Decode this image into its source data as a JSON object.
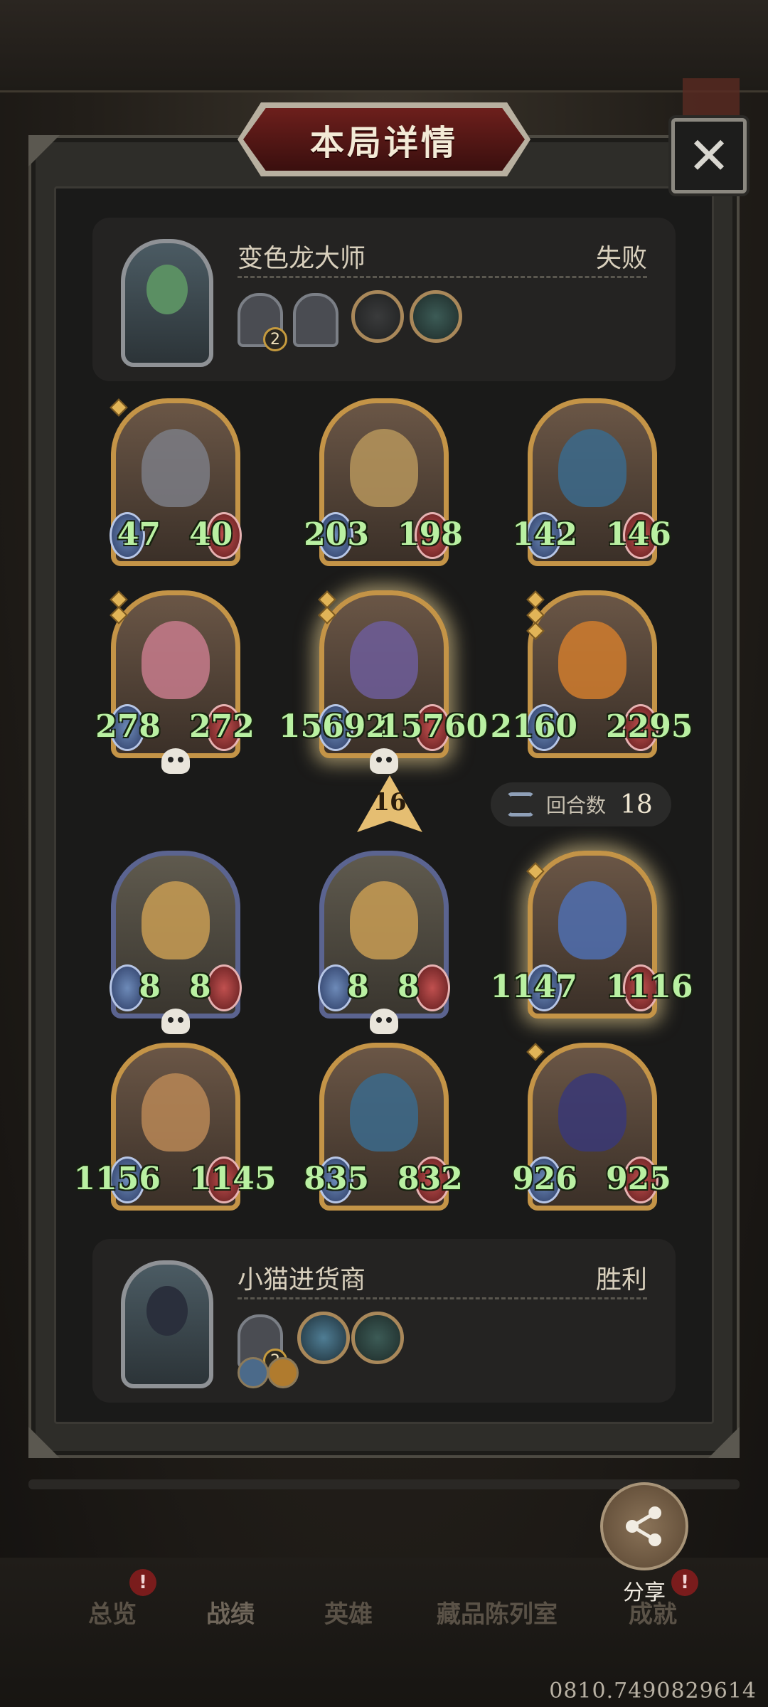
{
  "window": {
    "title": "本局详情",
    "close_glyph": "✕"
  },
  "opponent": {
    "name": "变色龙大师",
    "result": "失败",
    "portrait": "chameleon-master-portrait",
    "slots": [
      {
        "level": "2"
      }
    ],
    "relic_count": 3
  },
  "player": {
    "name": "小猫进货商",
    "result": "胜利",
    "portrait": "cat-merchant-portrait",
    "slots": [
      {
        "level": "2"
      }
    ]
  },
  "opponent_board": [
    {
      "name": "knight-minion",
      "attack": "47",
      "health": "40",
      "dead": false,
      "stars": 1
    },
    {
      "name": "scarecrow-minion",
      "attack": "203",
      "health": "198",
      "dead": false,
      "stars": 0
    },
    {
      "name": "elf-sorceress-minion",
      "attack": "142",
      "health": "146",
      "dead": false,
      "stars": 0
    },
    {
      "name": "dryad-minion",
      "attack": "278",
      "health": "272",
      "dead": true,
      "stars": 2
    },
    {
      "name": "dragon-minion",
      "attack": "15692",
      "health": "15760",
      "dead": true,
      "stars": 2
    },
    {
      "name": "pumpkin-minion",
      "attack": "2160",
      "health": "2295",
      "dead": false,
      "stars": 3
    }
  ],
  "player_board": [
    {
      "name": "pinocchio-minion",
      "attack": "8",
      "health": "8",
      "dead": true
    },
    {
      "name": "pinocchio-minion",
      "attack": "8",
      "health": "8",
      "dead": true
    },
    {
      "name": "star-mage-minion",
      "attack": "1147",
      "health": "1116",
      "dead": false
    },
    {
      "name": "dwarf-king-minion",
      "attack": "1156",
      "health": "1145",
      "dead": false
    },
    {
      "name": "elf-sorceress-minion",
      "attack": "835",
      "health": "832",
      "dead": false
    },
    {
      "name": "witch-hat-minion",
      "attack": "926",
      "health": "925",
      "dead": false
    }
  ],
  "turn": {
    "value": "16",
    "round_label": "回合数",
    "round_value": "18"
  },
  "nav": {
    "items": [
      "总览",
      "战绩",
      "英雄",
      "藏品陈列室",
      "成就"
    ],
    "active": "战绩",
    "badge": "!"
  },
  "share": {
    "label": "分享"
  },
  "footer": {
    "coords": "0810.7490829614"
  },
  "colors": {
    "gold_frame": "#c49447",
    "blue_frame": "#5b6490",
    "stat_green": "#b9f0a2",
    "title_red": "#6d1f1c"
  }
}
